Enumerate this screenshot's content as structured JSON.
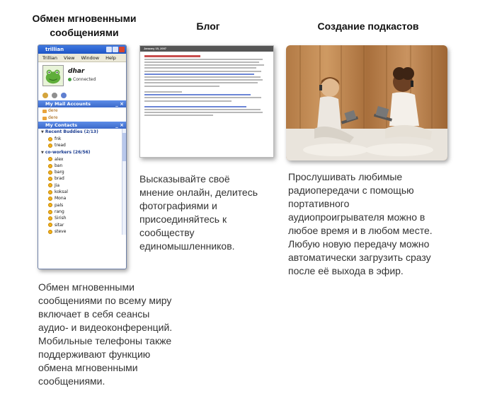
{
  "columns": [
    {
      "title": "Обмен мгновенными сообщениями",
      "description": "Обмен мгновенными сообщениями по всему миру включает в себя сеансы аудио- и видеоконференций. Мобильные телефоны также поддерживают функцию обмена мгновенными сообщениями."
    },
    {
      "title": "Блог",
      "description": "Высказывайте своё мнение онлайн, делитесь фотографиями и присоединяйтесь к сообществу единомышленников."
    },
    {
      "title": "Создание подкастов",
      "description": "Прослушивать любимые радиопередачи с помощью портативного аудиопроигрывателя можно в любое время и в любом месте. Любую новую передачу можно автоматически загрузить сразу после её выхода в эфир."
    }
  ],
  "im_window": {
    "app_title": "trillian",
    "menu": [
      "Trillian",
      "View",
      "Window",
      "Help"
    ],
    "username": "dhar",
    "status": "Connected",
    "mail_section": "My Mail Accounts",
    "mail_accounts": [
      "dere",
      "dere"
    ],
    "contacts_section": "My Contacts",
    "groups": [
      {
        "name": "Recent Buddies (2/13)",
        "buddies": [
          "fnk",
          "tread"
        ]
      },
      {
        "name": "co-workers (26/56)",
        "buddies": [
          "alex",
          "ban",
          "barg",
          "brad",
          "Jia",
          "koksal",
          "Mona",
          "pals",
          "rang",
          "Sirish",
          "sitar",
          "steve"
        ]
      }
    ]
  },
  "blog_shot": {
    "header": "January 15, 2007"
  },
  "colors": {
    "im_titlebar": "#2a62d6",
    "section_header": "#4a78d8"
  }
}
